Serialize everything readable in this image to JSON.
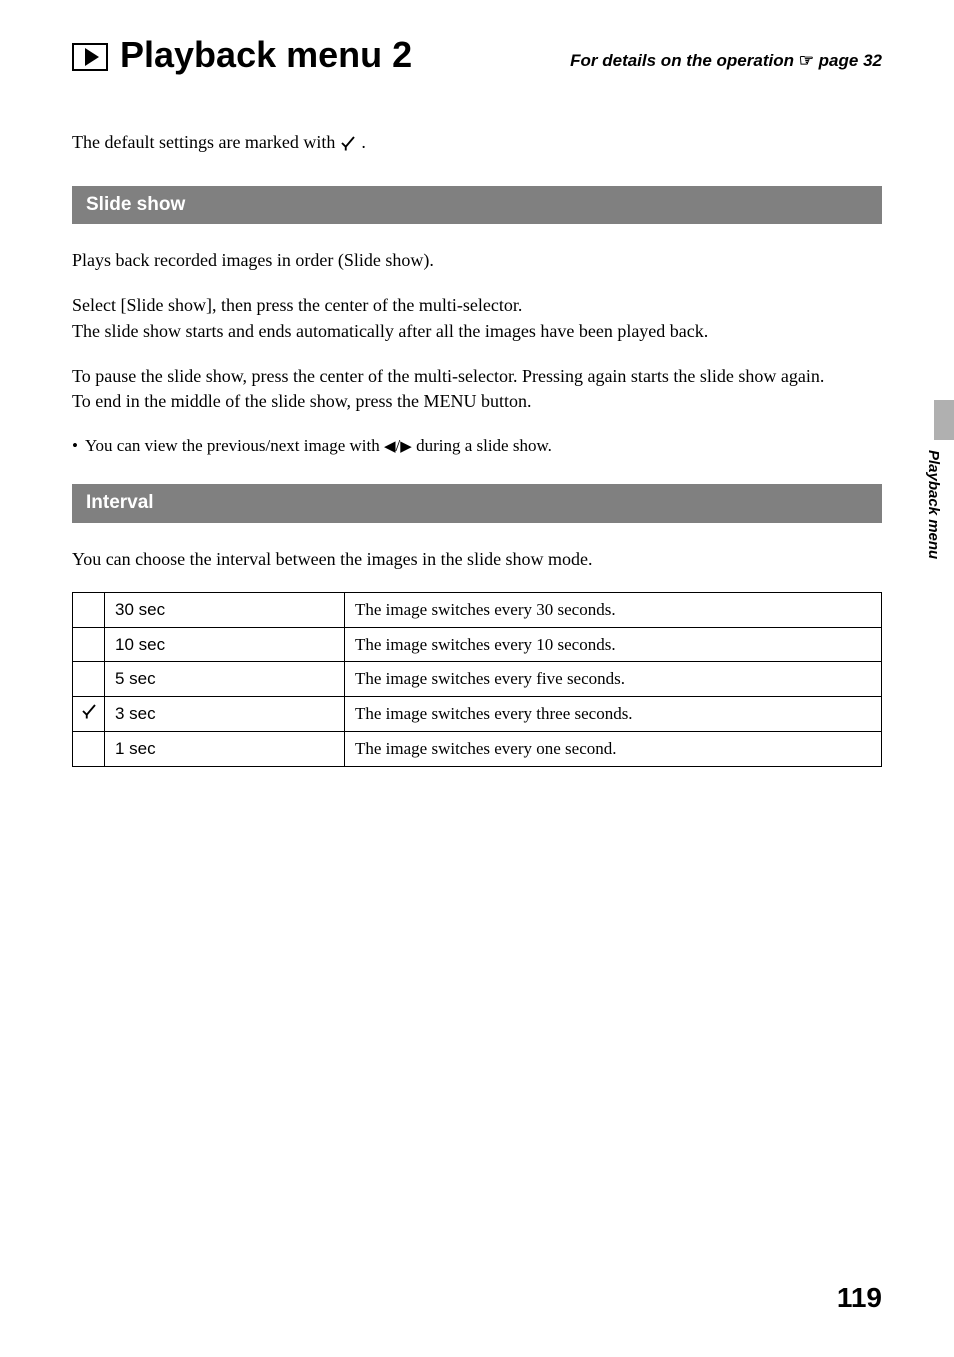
{
  "header": {
    "title": "Playback menu 2",
    "link_prefix": "For details on the operation ",
    "link_suffix": " page 32"
  },
  "intro": {
    "text_before": "The default settings are marked with ",
    "text_after": "."
  },
  "sections": {
    "slideshow": {
      "heading": "Slide show",
      "para1": "Plays back recorded images in order (Slide show).",
      "para2a": "Select [Slide show], then press the center of the multi-selector.",
      "para2b": "The slide show starts and ends automatically after all the images have been played back.",
      "para3a": "To pause the slide show, press the center of the multi-selector. Pressing again starts the slide show again.",
      "para3b": "To end in the middle of the slide show, press the MENU button.",
      "bullet_before": "You can view the previous/next image with ",
      "bullet_after": " during a slide show."
    },
    "interval": {
      "heading": "Interval",
      "para": "You can choose the interval between the images in the slide show mode.",
      "rows": [
        {
          "default": false,
          "option": "30 sec",
          "desc": "The image switches every 30 seconds."
        },
        {
          "default": false,
          "option": "10 sec",
          "desc": "The image switches every 10 seconds."
        },
        {
          "default": false,
          "option": "5 sec",
          "desc": "The image switches every five seconds."
        },
        {
          "default": true,
          "option": "3 sec",
          "desc": "The image switches every three seconds."
        },
        {
          "default": false,
          "option": "1 sec",
          "desc": "The image switches every one second."
        }
      ]
    }
  },
  "side_label": "Playback menu",
  "page_number": "119"
}
